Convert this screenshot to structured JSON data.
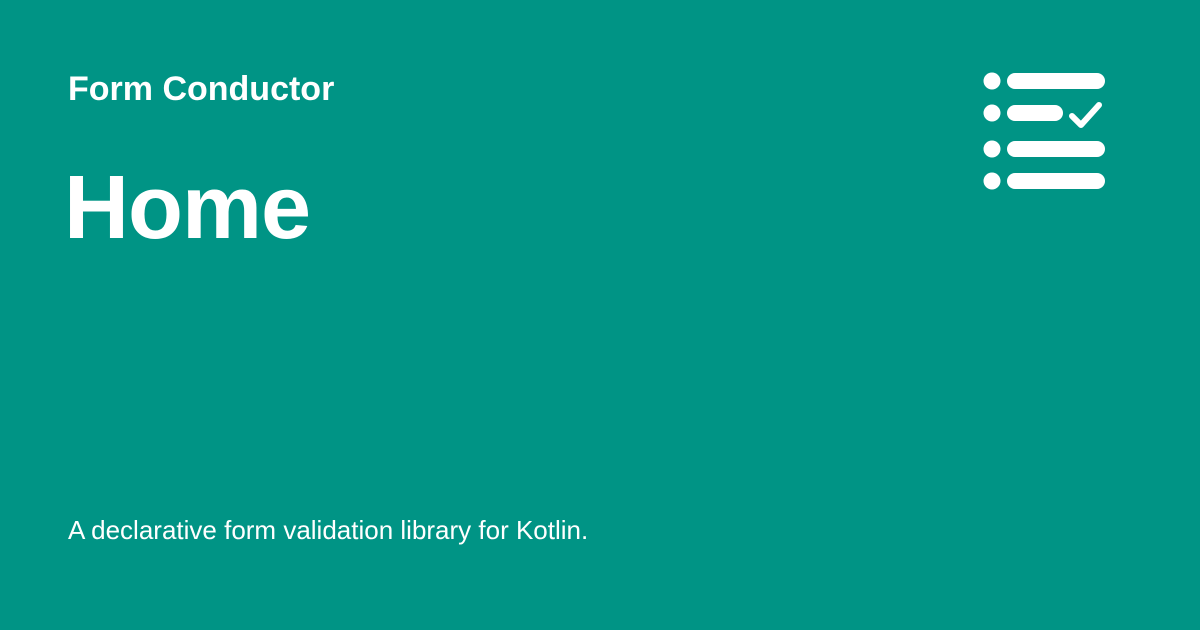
{
  "header": {
    "site_name": "Form Conductor",
    "page_title": "Home"
  },
  "footer": {
    "description": "A declarative form validation library for Kotlin."
  },
  "logo": {
    "icon": "checklist-icon"
  },
  "colors": {
    "background": "#009485",
    "foreground": "#ffffff"
  }
}
